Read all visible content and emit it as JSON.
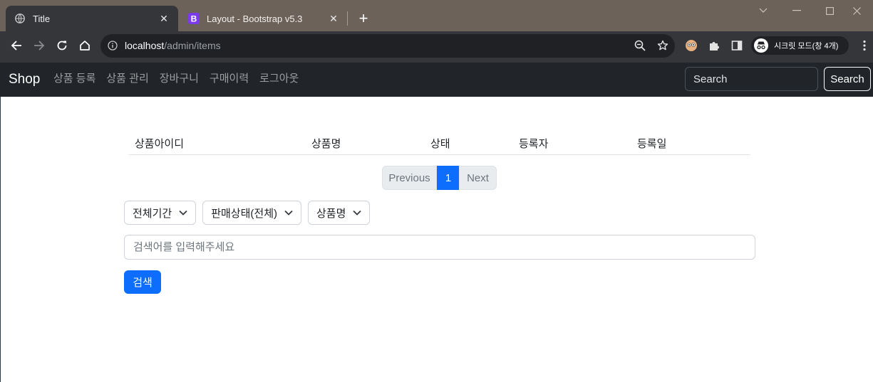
{
  "browser": {
    "tabs": [
      {
        "title": "Title",
        "active": true
      },
      {
        "title": "Layout - Bootstrap v5.3",
        "active": false
      }
    ],
    "url_host": "localhost",
    "url_path": "/admin/items",
    "incognito_label": "시크릿 모드(창 4개)"
  },
  "navbar": {
    "brand": "Shop",
    "links": [
      "상품 등록",
      "상품 관리",
      "장바구니",
      "구매이력",
      "로그아웃"
    ],
    "search_placeholder": "Search",
    "search_button": "Search"
  },
  "table": {
    "headers": [
      "상품아이디",
      "상품명",
      "상태",
      "등록자",
      "등록일"
    ],
    "rows": []
  },
  "pagination": {
    "previous": "Previous",
    "current_page": "1",
    "next": "Next"
  },
  "filters": {
    "period": "전체기간",
    "sale_status": "판매상태(전체)",
    "search_by": "상품명"
  },
  "search": {
    "placeholder": "검색어를 입력해주세요",
    "button": "검색"
  },
  "colors": {
    "primary": "#0d6efd",
    "navbar_bg": "#212529",
    "browser_frame": "#6d625a"
  }
}
